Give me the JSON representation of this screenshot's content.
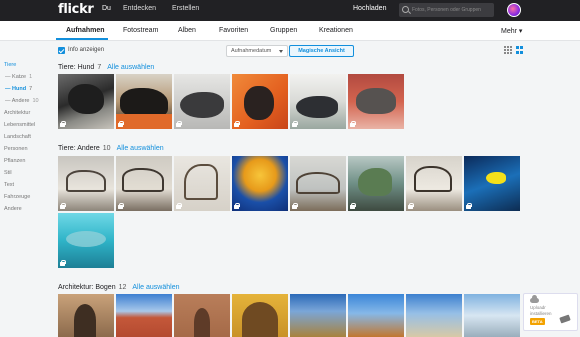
{
  "topbar": {
    "logo": "flickr",
    "nav": [
      "Du",
      "Entdecken",
      "Erstellen"
    ],
    "upload": "Hochladen",
    "search_placeholder": "Fotos, Personen oder Gruppen"
  },
  "subnav": {
    "tabs": [
      "Aufnahmen",
      "Fotostream",
      "Alben",
      "Favoriten",
      "Gruppen",
      "Kreationen"
    ],
    "more": "Mehr ▾"
  },
  "toolbar": {
    "info_label": "Info anzeigen",
    "sort_label": "Aufnahmedatum",
    "magic_label": "Magische Ansicht"
  },
  "sidebar": {
    "items": [
      {
        "label": "Tiere",
        "count": ""
      },
      {
        "label": "— Katze",
        "count": "1"
      },
      {
        "label": "— Hund",
        "count": "7"
      },
      {
        "label": "— Andere",
        "count": "10"
      },
      {
        "label": "Architektur",
        "count": ""
      },
      {
        "label": "Lebensmittel",
        "count": ""
      },
      {
        "label": "Landschaft",
        "count": ""
      },
      {
        "label": "Personen",
        "count": ""
      },
      {
        "label": "Pflanzen",
        "count": ""
      },
      {
        "label": "Stil",
        "count": ""
      },
      {
        "label": "Text",
        "count": ""
      },
      {
        "label": "Fahrzeuge",
        "count": ""
      },
      {
        "label": "Andere",
        "count": ""
      }
    ]
  },
  "sections": [
    {
      "title": "Tiere: Hund",
      "count": "7",
      "select_all": "Alle auswählen"
    },
    {
      "title": "Tiere: Andere",
      "count": "10",
      "select_all": "Alle auswählen"
    },
    {
      "title": "Architektur: Bogen",
      "count": "12",
      "select_all": "Alle auswählen"
    }
  ],
  "upload_widget": {
    "text": "Uploadr installieren",
    "badge": "BETA"
  },
  "colors": {
    "accent": "#128fdc",
    "topbar": "#212124",
    "background": "#f3f5f6"
  }
}
